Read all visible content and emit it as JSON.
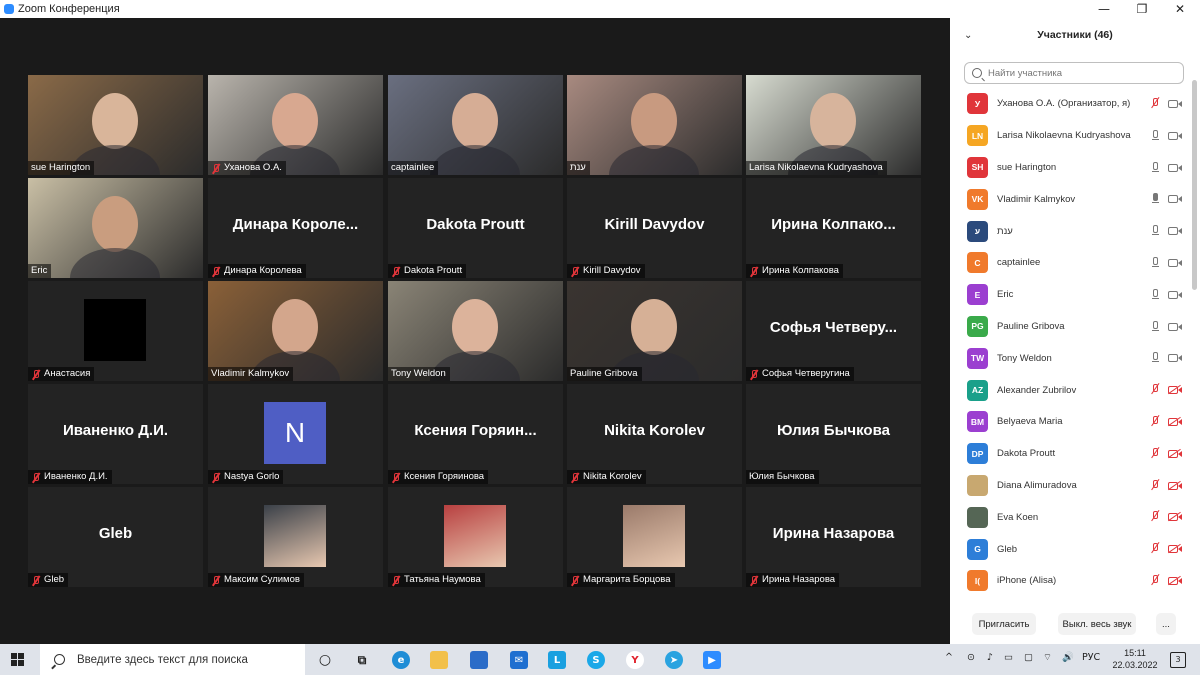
{
  "window": {
    "title": "Zoom Конференция",
    "minimize": "—",
    "maximize": "❐",
    "close": "✕"
  },
  "tiles": [
    {
      "name": "sue Harington",
      "big": "",
      "muted": false,
      "video": true,
      "bg": "#8a6a48",
      "face": "#d9b59a",
      "active": false
    },
    {
      "name": "Уханова О.А.",
      "big": "",
      "muted": true,
      "video": true,
      "bg": "#b9b4ac",
      "face": "#d8a890",
      "active": false
    },
    {
      "name": "captainlee",
      "big": "",
      "muted": false,
      "video": true,
      "bg": "#6a6f80",
      "face": "#d6ad95",
      "active": false
    },
    {
      "name": "ענת",
      "big": "",
      "muted": false,
      "video": true,
      "bg": "#a88a80",
      "face": "#c89a80",
      "active": false
    },
    {
      "name": "Larisa Nikolaevna Kudryashova",
      "big": "",
      "muted": false,
      "video": true,
      "bg": "#d7dbd0",
      "face": "#d7b49c",
      "active": true
    },
    {
      "name": "Eric",
      "big": "",
      "muted": false,
      "video": true,
      "bg": "#c9bfa5",
      "face": "#c99d7f",
      "active": false
    },
    {
      "name": "Динара Королева",
      "big": "Динара Короле...",
      "muted": true,
      "video": false
    },
    {
      "name": "Dakota Proutt",
      "big": "Dakota Proutt",
      "muted": true,
      "video": false
    },
    {
      "name": "Kirill Davydov",
      "big": "Kirill Davydov",
      "muted": true,
      "video": false
    },
    {
      "name": "Ирина Колпакова",
      "big": "Ирина Колпако...",
      "muted": true,
      "video": false
    },
    {
      "name": "Анастасия",
      "big": "",
      "muted": true,
      "video": true,
      "bg": "#232323",
      "face": "",
      "active": false,
      "black": true
    },
    {
      "name": "Vladimir Kalmykov",
      "big": "",
      "muted": false,
      "video": true,
      "bg": "#8a6038",
      "face": "#d3a68c",
      "active": false
    },
    {
      "name": "Tony Weldon",
      "big": "",
      "muted": false,
      "video": true,
      "bg": "#8a8476",
      "face": "#dcb39b",
      "active": false
    },
    {
      "name": "Pauline Gribova",
      "big": "",
      "muted": false,
      "video": true,
      "bg": "#3a3430",
      "face": "#d6b096",
      "active": false
    },
    {
      "name": "Софья Четверугина",
      "big": "Софья Четверу...",
      "muted": true,
      "video": false
    },
    {
      "name": "Иваненко Д.И.",
      "big": "Иваненко Д.И.",
      "muted": true,
      "video": false
    },
    {
      "name": "Nastya Gorlo",
      "big": "",
      "muted": true,
      "video": false,
      "letter": "N"
    },
    {
      "name": "Ксения Горяинова",
      "big": "Ксения Горяин...",
      "muted": true,
      "video": false
    },
    {
      "name": "Nikita Korolev",
      "big": "Nikita Korolev",
      "muted": true,
      "video": false
    },
    {
      "name": "Юлия Бычкова",
      "big": "Юлия Бычкова",
      "muted": false,
      "video": false
    },
    {
      "name": "Gleb",
      "big": "Gleb",
      "muted": true,
      "video": false
    },
    {
      "name": "Максим Сулимов",
      "big": "",
      "muted": true,
      "video": false,
      "thumb": "#3a4048"
    },
    {
      "name": "Татьяна Наумова",
      "big": "",
      "muted": true,
      "video": false,
      "thumb": "#b84040"
    },
    {
      "name": "Маргарита Борцова",
      "big": "",
      "muted": true,
      "video": false,
      "thumb": "#9a7a6a"
    },
    {
      "name": "Ирина Назарова",
      "big": "Ирина Назарова",
      "muted": true,
      "video": false
    }
  ],
  "participants_panel": {
    "title": "Участники (46)",
    "search_placeholder": "Найти участника",
    "invite_label": "Пригласить",
    "mute_all_label": "Выкл. весь звук",
    "more_label": "...",
    "participants": [
      {
        "name": "Уханова О.А. (Организатор, я)",
        "initials": "У",
        "color": "#e0353a",
        "mic": "off",
        "cam": "on"
      },
      {
        "name": "Larisa Nikolaevna Kudryashova",
        "initials": "LN",
        "color": "#f5a623",
        "mic": "idle",
        "cam": "on"
      },
      {
        "name": "sue Harington",
        "initials": "SH",
        "color": "#e0353a",
        "mic": "idle",
        "cam": "on"
      },
      {
        "name": "Vladimir Kalmykov",
        "initials": "VK",
        "color": "#f07a2c",
        "mic": "active",
        "cam": "on"
      },
      {
        "name": "ענת",
        "initials": "ע",
        "color": "#2b4a7c",
        "mic": "idle",
        "cam": "on"
      },
      {
        "name": "captainlee",
        "initials": "C",
        "color": "#f07a2c",
        "mic": "idle",
        "cam": "on"
      },
      {
        "name": "Eric",
        "initials": "E",
        "color": "#9b3fd0",
        "mic": "idle",
        "cam": "on"
      },
      {
        "name": "Pauline Gribova",
        "initials": "PG",
        "color": "#3aaa4a",
        "mic": "idle",
        "cam": "on"
      },
      {
        "name": "Tony Weldon",
        "initials": "TW",
        "color": "#9b3fd0",
        "mic": "idle",
        "cam": "on"
      },
      {
        "name": "Alexander Zubrilov",
        "initials": "AZ",
        "color": "#1aa08a",
        "mic": "off",
        "cam": "off"
      },
      {
        "name": "Belyaeva Maria",
        "initials": "BM",
        "color": "#9b3fd0",
        "mic": "off",
        "cam": "off"
      },
      {
        "name": "Dakota Proutt",
        "initials": "DP",
        "color": "#2d7ed8",
        "mic": "off",
        "cam": "off"
      },
      {
        "name": "Diana Alimuradova",
        "initials": "",
        "color": "#c8a870",
        "mic": "off",
        "cam": "off"
      },
      {
        "name": "Eva Koen",
        "initials": "",
        "color": "#556655",
        "mic": "off",
        "cam": "off"
      },
      {
        "name": "Gleb",
        "initials": "G",
        "color": "#2d7ed8",
        "mic": "off",
        "cam": "off"
      },
      {
        "name": "iPhone (Alisa)",
        "initials": "I(",
        "color": "#f07a2c",
        "mic": "off",
        "cam": "off"
      }
    ]
  },
  "taskbar": {
    "search_placeholder": "Введите здесь текст для поиска",
    "language": "РУС",
    "time": "15:11",
    "date": "22.03.2022",
    "notification_count": "3"
  }
}
